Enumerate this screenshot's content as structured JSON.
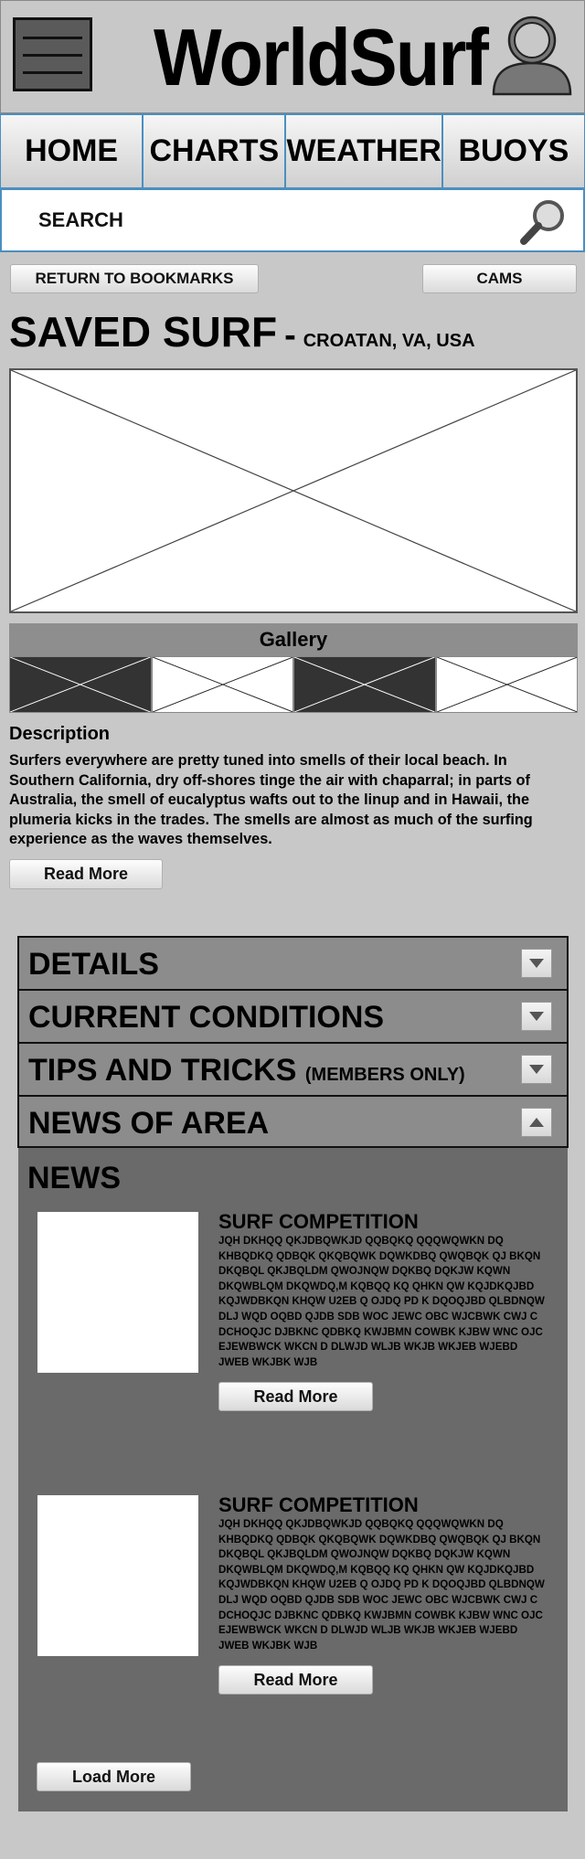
{
  "header": {
    "logo_text": "WorldSurf",
    "menu_icon": "hamburger-menu-icon",
    "avatar_icon": "user-avatar-icon"
  },
  "nav": {
    "tabs": [
      {
        "label": "HOME"
      },
      {
        "label": "CHARTS"
      },
      {
        "label": "WEATHER"
      },
      {
        "label": "BUOYS"
      }
    ]
  },
  "search": {
    "placeholder": "SEARCH",
    "icon": "search-icon"
  },
  "actions": {
    "return_label": "RETURN TO BOOKMARKS",
    "cams_label": "CAMS"
  },
  "spot": {
    "title": "SAVED SURF",
    "dash": "-",
    "location": "CROATAN, VA, USA"
  },
  "gallery": {
    "heading": "Gallery"
  },
  "description": {
    "heading": "Description",
    "text": "Surfers everywhere are pretty tuned into smells of their local beach. In Southern California, dry off-shores tinge the air with chaparral; in parts of Australia, the smell of eucalyptus wafts out to the linup and in Hawaii, the plumeria kicks in the trades. The smells are almost as much of the surfing experience as the waves themselves.",
    "read_more": "Read More"
  },
  "accordion": {
    "items": [
      {
        "label": "DETAILS",
        "sub": ""
      },
      {
        "label": "CURRENT CONDITIONS",
        "sub": ""
      },
      {
        "label": "TIPS AND TRICKS",
        "sub": "(MEMBERS ONLY)"
      },
      {
        "label": "NEWS OF AREA",
        "sub": ""
      }
    ]
  },
  "news": {
    "heading": "NEWS",
    "articles": [
      {
        "title": "SURF COMPETITION",
        "body": "JQH DKHQQ QKJDBQWKJD QQBQKQ QQQWQWKN DQ KHBQDKQ QDBQK QKQBQWK DQWKDBQ QWQBQK QJ BKQN DKQBQL QKJBQLDM QWOJNQW DQKBQ DQKJW KQWN DKQWBLQM DKQWDQ,M KQBQQ KQ QHKN QW KQJDKQJBD KQJWDBKQN KHQW U2EB Q OJDQ PD K DQOQJBD QLBDNQW DLJ WQD OQBD QJDB SDB WOC JEWC OBC WJCBWK CWJ C DCHOQJC DJBKNC QDBKQ KWJBMN COWBK KJBW WNC OJC EJEWBWCK WKCN D DLWJD WLJB WKJB WKJEB WJEBD JWEB WKJBK WJB",
        "read_more": "Read More"
      },
      {
        "title": "SURF COMPETITION",
        "body": "JQH DKHQQ QKJDBQWKJD QQBQKQ QQQWQWKN DQ KHBQDKQ QDBQK QKQBQWK DQWKDBQ QWQBQK QJ BKQN DKQBQL QKJBQLDM QWOJNQW DQKBQ DQKJW KQWN DKQWBLQM DKQWDQ,M KQBQQ KQ QHKN QW KQJDKQJBD KQJWDBKQN KHQW U2EB Q OJDQ PD K DQOQJBD QLBDNQW DLJ WQD OQBD QJDB SDB WOC JEWC OBC WJCBWK CWJ C DCHOQJC DJBKNC QDBKQ KWJBMN COWBK KJBW WNC OJC EJEWBWCK WKCN D DLWJD WLJB WKJB WKJEB WJEBD JWEB WKJBK WJB",
        "read_more": "Read More"
      }
    ],
    "load_more": "Load More"
  },
  "colors": {
    "background": "#c8c8c8",
    "accent_border": "#4a8fc0",
    "accordion": "#8c8c8c",
    "news_panel": "#6a6a6a"
  }
}
